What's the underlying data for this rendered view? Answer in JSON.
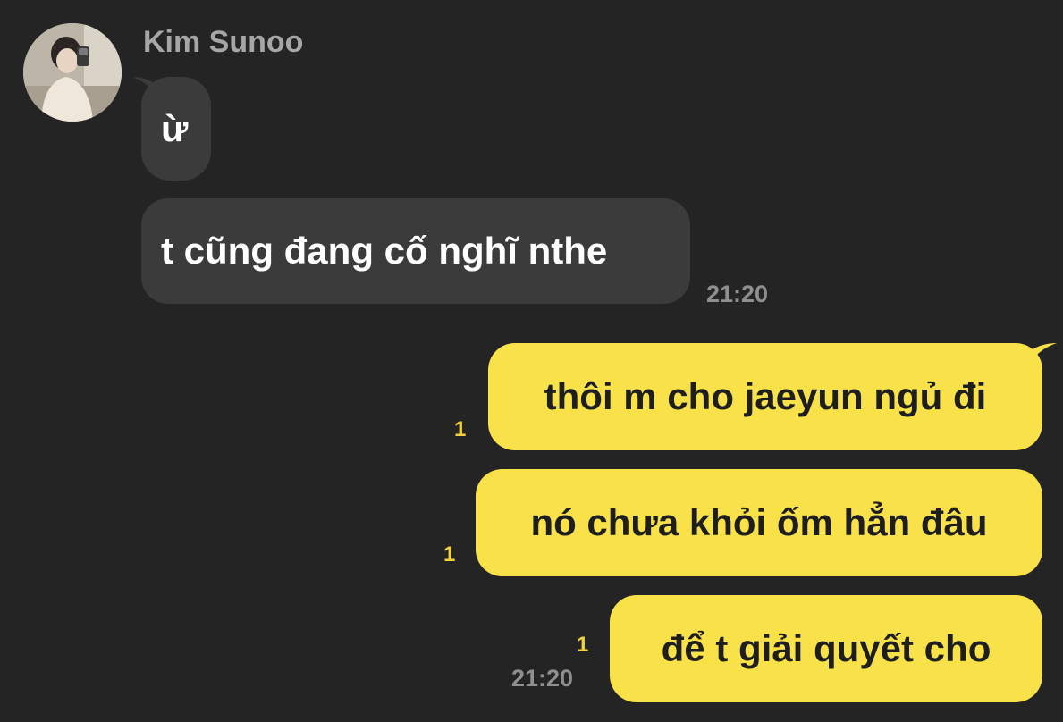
{
  "contact": {
    "name": "Kim Sunoo",
    "avatar_icon": "user-profile-photo"
  },
  "messages_in": [
    {
      "text": "ừ"
    },
    {
      "text": "t cũng đang cố nghĩ nthe",
      "time": "21:20"
    }
  ],
  "messages_out": [
    {
      "text": "thôi m cho jaeyun ngủ đi",
      "unread": "1"
    },
    {
      "text": "nó chưa khỏi ốm hẳn đâu",
      "unread": "1"
    },
    {
      "text": "để t giải quyết cho",
      "unread": "1",
      "time": "21:20"
    }
  ],
  "colors": {
    "background": "#242424",
    "incoming_bubble": "#3b3b3b",
    "outgoing_bubble": "#f9e14a",
    "unread_count": "#f2d33e"
  }
}
